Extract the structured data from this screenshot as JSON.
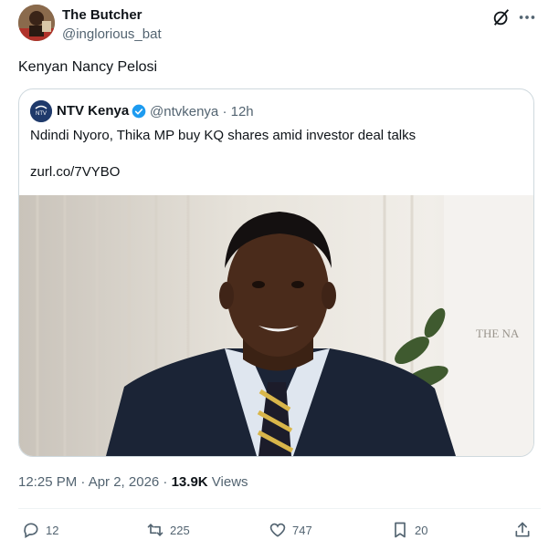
{
  "tweet": {
    "author_name": "The Butcher",
    "author_handle": "@inglorious_bat",
    "text": "Kenyan Nancy Pelosi",
    "time": "12:25 PM · Apr 2, 2026 · ",
    "views_count": "13.9K",
    "views_label": " Views"
  },
  "quote": {
    "author_name": "NTV Kenya",
    "author_handle": "@ntvkenya",
    "age": "· 12h",
    "text": "Ndindi Nyoro, Thika MP buy KQ shares amid investor deal talks",
    "link": "zurl.co/7VYBO",
    "avatar_text": "NTV",
    "watermark": "THE NA"
  },
  "actions": {
    "replies": "12",
    "reposts": "225",
    "likes": "747",
    "bookmarks": "20"
  },
  "colors": {
    "text": "#0f1419",
    "muted": "#536471",
    "verified": "#1d9bf0",
    "border": "#cfd9de"
  },
  "icons": [
    "grok-icon",
    "more-icon",
    "verified-badge-icon",
    "reply-icon",
    "repost-icon",
    "like-icon",
    "bookmark-icon",
    "share-icon"
  ]
}
